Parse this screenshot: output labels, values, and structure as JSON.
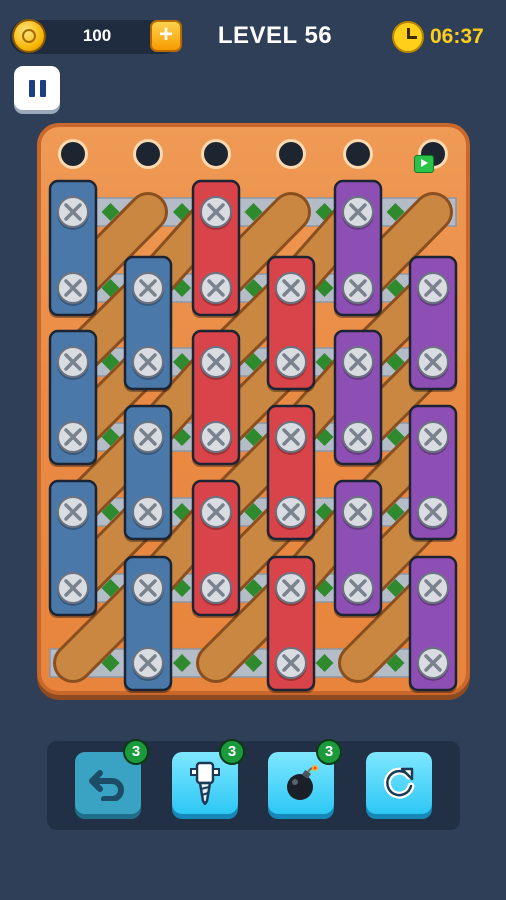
{
  "header": {
    "coins": "100",
    "coin_add_label": "+",
    "level_title": "LEVEL 56",
    "timer": "06:37"
  },
  "colors": {
    "background": "#2e3f57",
    "board_wood": "#eb8c47",
    "blue": "#4a78a8",
    "red": "#d9434a",
    "purple": "#8e4fb5",
    "plank": "#c98742",
    "screw": "#d9dde2",
    "badge": "#1a9a3a"
  },
  "board": {
    "hole_columns": 6,
    "holes_top_row": 6,
    "play_badge_icon": "play-icon"
  },
  "bars": [
    {
      "color": "blue",
      "col": 0,
      "rows": [
        0,
        1
      ]
    },
    {
      "color": "blue",
      "col": 1,
      "rows": [
        1,
        2
      ]
    },
    {
      "color": "blue",
      "col": 0,
      "rows": [
        2,
        3
      ]
    },
    {
      "color": "blue",
      "col": 1,
      "rows": [
        3,
        4
      ]
    },
    {
      "color": "blue",
      "col": 0,
      "rows": [
        4,
        5
      ]
    },
    {
      "color": "blue",
      "col": 1,
      "rows": [
        5,
        6
      ]
    },
    {
      "color": "red",
      "col": 2,
      "rows": [
        0,
        1
      ]
    },
    {
      "color": "red",
      "col": 3,
      "rows": [
        1,
        2
      ]
    },
    {
      "color": "red",
      "col": 2,
      "rows": [
        2,
        3
      ]
    },
    {
      "color": "red",
      "col": 3,
      "rows": [
        3,
        4
      ]
    },
    {
      "color": "red",
      "col": 2,
      "rows": [
        4,
        5
      ]
    },
    {
      "color": "red",
      "col": 3,
      "rows": [
        5,
        6
      ]
    },
    {
      "color": "purple",
      "col": 4,
      "rows": [
        0,
        1
      ]
    },
    {
      "color": "purple",
      "col": 5,
      "rows": [
        1,
        2
      ]
    },
    {
      "color": "purple",
      "col": 4,
      "rows": [
        2,
        3
      ]
    },
    {
      "color": "purple",
      "col": 5,
      "rows": [
        3,
        4
      ]
    },
    {
      "color": "purple",
      "col": 4,
      "rows": [
        4,
        5
      ]
    },
    {
      "color": "purple",
      "col": 5,
      "rows": [
        5,
        6
      ]
    }
  ],
  "toolbar": {
    "tools": [
      {
        "name": "undo-button",
        "icon": "undo-icon",
        "count": "3"
      },
      {
        "name": "drill-button",
        "icon": "drill-icon",
        "count": "3"
      },
      {
        "name": "bomb-button",
        "icon": "bomb-icon",
        "count": "3"
      },
      {
        "name": "restart-button",
        "icon": "restart-icon",
        "count": ""
      }
    ]
  }
}
